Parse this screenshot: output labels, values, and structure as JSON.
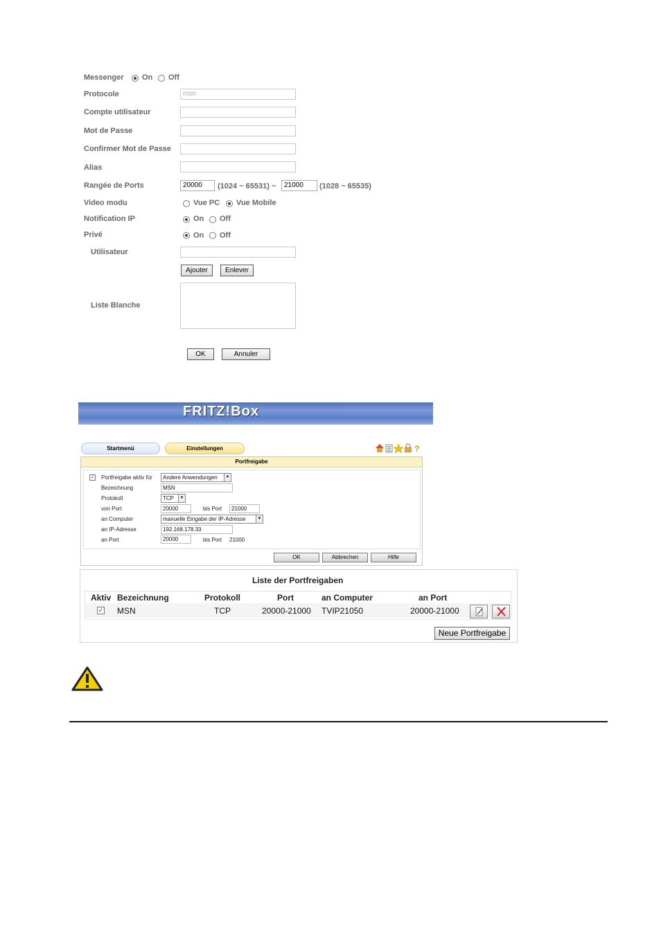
{
  "messenger": {
    "messenger_label": "Messenger",
    "messenger_on": "On",
    "messenger_off": "Off",
    "protocole_label": "Protocole",
    "protocole_value": "msn",
    "compte_label": "Compte utilisateur",
    "mot_de_passe_label": "Mot de Passe",
    "confirmer_label": "Confirmer Mot de Passe",
    "alias_label": "Alias",
    "ports_label": "Rangée de Ports",
    "port_from": "20000",
    "port_from_range": "(1024 ~ 65531) ~",
    "port_to": "21000",
    "port_to_range": "(1028 ~ 65535)",
    "video_label": "Video modu",
    "video_pc": "Vue PC",
    "video_mobile": "Vue Mobile",
    "notification_label": "Notification IP",
    "notification_on": "On",
    "notification_off": "Off",
    "prive_label": "Privé",
    "prive_on": "On",
    "prive_off": "Off",
    "utilisateur_label": "Utilisateur",
    "ajouter": "Ajouter",
    "enlever": "Enlever",
    "liste_blanche_label": "Liste Blanche",
    "ok": "OK",
    "annuler": "Annuler"
  },
  "fritzbox": {
    "logo": "FRITZ!Box",
    "tab_startmenu": "Startmenü",
    "tab_einstellungen": "Einstellungen",
    "panel_title": "Portfreigabe",
    "portfreigabe_label": "Portfreigabe aktiv für",
    "portfreigabe_value": "Andere Anwendungen",
    "bezeichnung_label": "Bezeichnung",
    "bezeichnung_value": "MSN",
    "protokoll_label": "Protokoll",
    "protokoll_value": "TCP",
    "von_port_label": "von Port",
    "von_port_value": "20000",
    "bis_port_label": "bis Port",
    "bis_port_value": "21000",
    "an_computer_label": "an Computer",
    "an_computer_value": "manuelle Eingabe der IP-Adresse",
    "an_ip_label": "an IP-Adresse",
    "an_ip_value": "192.168.178.33",
    "an_port_label": "an Port",
    "an_port_value": "20000",
    "an_bis_port_label": "bis Port",
    "an_bis_port_value": "21000",
    "ok": "OK",
    "abbrechen": "Abbrechen",
    "hilfe": "Hilfe"
  },
  "portlist": {
    "title": "Liste der Portfreigaben",
    "headers": [
      "Aktiv",
      "Bezeichnung",
      "Protokoll",
      "Port",
      "an Computer",
      "an Port"
    ],
    "row": {
      "bezeichnung": "MSN",
      "protokoll": "TCP",
      "port": "20000-21000",
      "computer": "TVIP21050",
      "an_port": "20000-21000"
    },
    "new_button": "Neue Portfreigabe"
  },
  "colors": {
    "warning_fill": "#f5d000",
    "header_blue": "#5c7dc7",
    "panel_yellow": "#fbf1c4"
  }
}
